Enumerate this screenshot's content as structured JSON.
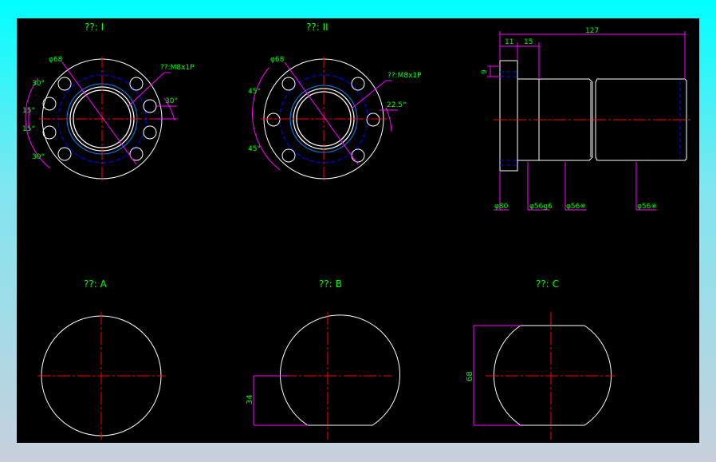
{
  "views": {
    "type1": "??: I",
    "type2": "??: II",
    "typeA": "??: A",
    "typeB": "??: B",
    "typeC": "??: C"
  },
  "flange1": {
    "dia": "φ68",
    "thread": "??:M8x1P",
    "ang30a": "30°",
    "ang15a": "15°",
    "ang15b": "15°",
    "ang30b": "30°",
    "ang30c": "30°"
  },
  "flange2": {
    "dia": "φ68",
    "thread": "??:M8x1P",
    "ang45a": "45°",
    "ang45b": "45°",
    "ang225": "22.5°"
  },
  "side": {
    "len127": "127",
    "len11": "11",
    "len15": "15",
    "len9": "9",
    "d80": "φ80",
    "d56g6": "φ56g6",
    "d56a": "φ56※",
    "d56b": "φ56※"
  },
  "shapes": {
    "dim34": "34",
    "dim68": "68"
  },
  "colors": {
    "background": "#000000",
    "outline": "#ffffff",
    "center": "#ff0000",
    "dimension": "#ff00ff",
    "text": "#00ff00",
    "hidden": "#0000ff"
  }
}
